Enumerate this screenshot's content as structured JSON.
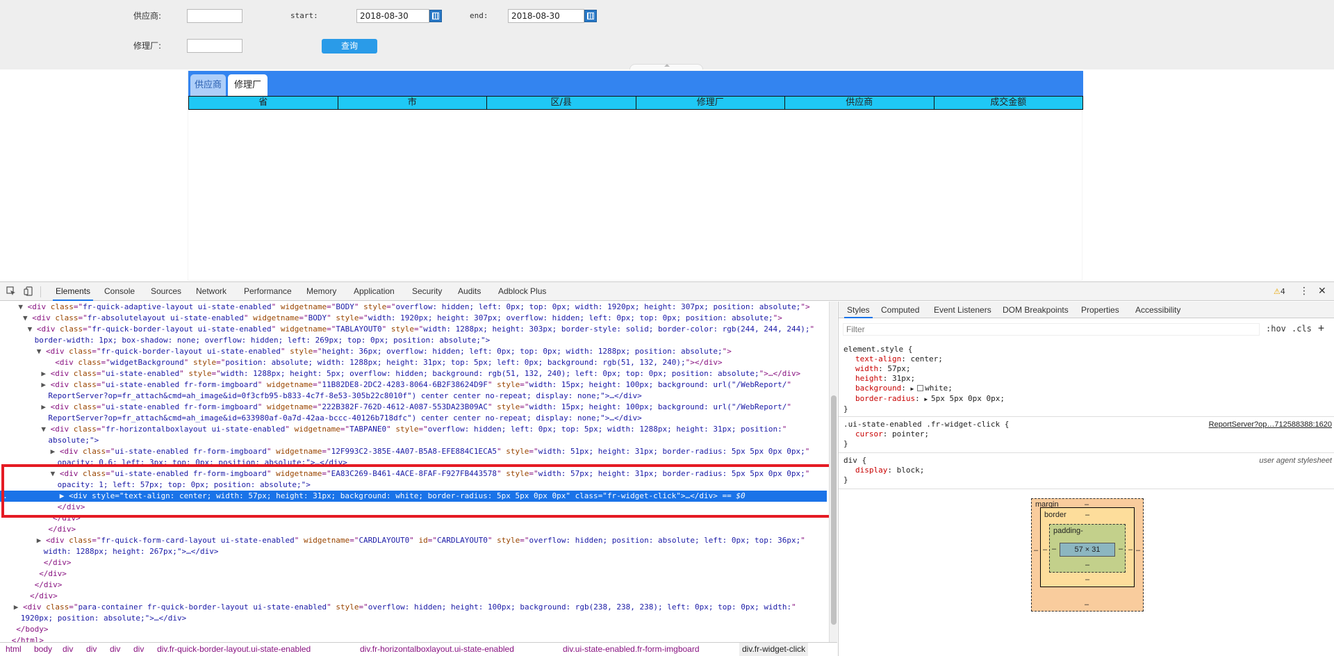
{
  "params": {
    "supplier_label": "供应商:",
    "start_label": "start:",
    "start_value": "2018-08-30",
    "end_label": "end:",
    "end_value": "2018-08-30",
    "repair_label": "修理厂:",
    "query_label": "查询"
  },
  "report": {
    "tabs": [
      "供应商",
      "修理厂"
    ],
    "columns": [
      "省",
      "市",
      "区/县",
      "修理厂",
      "供应商",
      "成交金额"
    ]
  },
  "devtools": {
    "tabs": [
      "Elements",
      "Console",
      "Sources",
      "Network",
      "Performance",
      "Memory",
      "Application",
      "Security",
      "Audits",
      "Adblock Plus"
    ],
    "warning_count": "4",
    "dom_lines": [
      {
        "indent": 4,
        "tri": "▼",
        "tag": "div",
        "attrs": [
          [
            "class",
            "fr-quick-adaptive-layout ui-state-enabled"
          ],
          [
            "widgetname",
            "BODY"
          ],
          [
            "style",
            "overflow: hidden; left: 0px; top: 0px; width: 1920px; height: 307px; position: absolute;"
          ]
        ],
        "end": ">"
      },
      {
        "indent": 5,
        "tri": "▼",
        "tag": "div",
        "attrs": [
          [
            "class",
            "fr-absolutelayout ui-state-enabled"
          ],
          [
            "widgetname",
            "BODY"
          ],
          [
            "style",
            "width: 1920px; height: 307px; overflow: hidden; left: 0px; top: 0px; position: absolute;"
          ]
        ],
        "end": ">"
      },
      {
        "indent": 6,
        "tri": "▼",
        "tag": "div",
        "attrs": [
          [
            "class",
            "fr-quick-border-layout ui-state-enabled"
          ],
          [
            "widgetname",
            "TABLAYOUT0"
          ],
          [
            "style",
            "width: 1288px; height: 303px; border-style: solid; border-color: rgb(244, 244, 244);"
          ]
        ],
        "end": ""
      },
      {
        "indent": 6,
        "text": "border-width: 1px; box-shadow: none; overflow: hidden; left: 269px; top: 0px; position: absolute;\">",
        "cont": true
      },
      {
        "indent": 8,
        "tri": "▼",
        "tag": "div",
        "attrs": [
          [
            "class",
            "fr-quick-border-layout ui-state-enabled"
          ],
          [
            "style",
            "height: 36px; overflow: hidden; left: 0px; top: 0px; width: 1288px; position: absolute;"
          ]
        ],
        "end": ">"
      },
      {
        "indent": 10,
        "tri": "",
        "tag": "div",
        "attrs": [
          [
            "class",
            "widgetBackground"
          ],
          [
            "style",
            "position: absolute; width: 1288px; height: 31px; top: 5px; left: 0px; background: rgb(51, 132, 240);"
          ]
        ],
        "end": "></div>"
      },
      {
        "indent": 9,
        "tri": "▶",
        "tag": "div",
        "attrs": [
          [
            "class",
            "ui-state-enabled"
          ],
          [
            "style",
            "width: 1288px; height: 5px; overflow: hidden; background: rgb(51, 132, 240); left: 0px; top: 0px; position: absolute;"
          ]
        ],
        "end": ">…</div>"
      },
      {
        "indent": 9,
        "tri": "▶",
        "tag": "div",
        "attrs": [
          [
            "class",
            "ui-state-enabled fr-form-imgboard"
          ],
          [
            "widgetname",
            "11B82DE8-2DC2-4283-8064-6B2F38624D9F"
          ],
          [
            "style",
            "width: 15px; height: 100px; background: url(\"/WebReport/"
          ]
        ],
        "end": ""
      },
      {
        "indent": 9,
        "text": "ReportServer?op=fr_attach&cmd=ah_image&id=0f3cfb95-b833-4c7f-8e53-305b22c8010f\") center center no-repeat; display: none;\">…</div>",
        "cont": true
      },
      {
        "indent": 9,
        "tri": "▶",
        "tag": "div",
        "attrs": [
          [
            "class",
            "ui-state-enabled fr-form-imgboard"
          ],
          [
            "widgetname",
            "222B382F-762D-4612-A087-553DA23B09AC"
          ],
          [
            "style",
            "width: 15px; height: 100px; background: url(\"/WebReport/"
          ]
        ],
        "end": ""
      },
      {
        "indent": 9,
        "text": "ReportServer?op=fr_attach&cmd=ah_image&id=633980af-0a7d-42aa-bccc-40126b718dfc\") center center no-repeat; display: none;\">…</div>",
        "cont": true
      },
      {
        "indent": 9,
        "tri": "▼",
        "tag": "div",
        "attrs": [
          [
            "class",
            "fr-horizontalboxlayout ui-state-enabled"
          ],
          [
            "widgetname",
            "TABPANE0"
          ],
          [
            "style",
            "overflow: hidden; left: 0px; top: 5px; width: 1288px; height: 31px; position:"
          ]
        ],
        "end": ""
      },
      {
        "indent": 9,
        "text": "absolute;\">",
        "cont": true
      },
      {
        "indent": 11,
        "tri": "▶",
        "tag": "div",
        "attrs": [
          [
            "class",
            "ui-state-enabled fr-form-imgboard"
          ],
          [
            "widgetname",
            "12F993C2-385E-4A07-B5A8-EFE884C1ECA5"
          ],
          [
            "style",
            "width: 51px; height: 31px; border-radius: 5px 5px 0px 0px;"
          ]
        ],
        "end": ""
      },
      {
        "indent": 11,
        "text": "opacity: 0.6; left: 3px; top: 0px; position: absolute;\">…</div>",
        "cont": true
      },
      {
        "indent": 11,
        "tri": "▼",
        "tag": "div",
        "attrs": [
          [
            "class",
            "ui-state-enabled fr-form-imgboard"
          ],
          [
            "widgetname",
            "EA83C269-B461-4ACE-8FAF-F927FB443578"
          ],
          [
            "style",
            "width: 57px; height: 31px; border-radius: 5px 5px 0px 0px;"
          ]
        ],
        "end": ""
      },
      {
        "indent": 11,
        "text": "opacity: 1; left: 57px; top: 0px; position: absolute;\">",
        "cont": true
      },
      {
        "indent": 13,
        "tri": "▶",
        "tag": "div",
        "attrs": [
          [
            "style",
            "text-align: center; width: 57px; height: 31px; background: white; border-radius: 5px 5px 0px 0px"
          ],
          [
            "class",
            "fr-widget-click"
          ]
        ],
        "end": ">…</div>",
        "sel": true
      },
      {
        "indent": 11,
        "text": "</div>",
        "close": true
      },
      {
        "indent": 10,
        "text": "</div>",
        "close": true
      },
      {
        "indent": 9,
        "text": "</div>",
        "close": true
      },
      {
        "indent": 8,
        "tri": "▶",
        "tag": "div",
        "attrs": [
          [
            "class",
            "fr-quick-form-card-layout ui-state-enabled"
          ],
          [
            "widgetname",
            "CARDLAYOUT0"
          ],
          [
            "id",
            "CARDLAYOUT0"
          ],
          [
            "style",
            "overflow: hidden; position: absolute; left: 0px; top: 36px;"
          ]
        ],
        "end": ""
      },
      {
        "indent": 8,
        "text": "width: 1288px; height: 267px;\">…</div>",
        "cont": true
      },
      {
        "indent": 8,
        "text": "</div>",
        "close": true
      },
      {
        "indent": 7,
        "text": "</div>",
        "close": true
      },
      {
        "indent": 6,
        "text": "</div>",
        "close": true
      },
      {
        "indent": 5,
        "text": "</div>",
        "close": true
      },
      {
        "indent": 3,
        "tri": "▶",
        "tag": "div",
        "attrs": [
          [
            "class",
            "para-container fr-quick-border-layout ui-state-enabled"
          ],
          [
            "style",
            "overflow: hidden; height: 100px; background: rgb(238, 238, 238); left: 0px; top: 0px; width:"
          ]
        ],
        "end": ""
      },
      {
        "indent": 3,
        "text": "1920px; position: absolute;\">…</div>",
        "cont": true
      },
      {
        "indent": 2,
        "text": "</body>",
        "close": true
      },
      {
        "indent": 1,
        "text": "</html>",
        "close": true
      }
    ],
    "selected_suffix": " == $0",
    "breadcrumbs": [
      "html",
      "body",
      "div",
      "div",
      "div",
      "div",
      "div.fr-quick-border-layout.ui-state-enabled",
      "div.fr-horizontalboxlayout.ui-state-enabled",
      "div.ui-state-enabled.fr-form-imgboard",
      "div.fr-widget-click"
    ]
  },
  "styles_panel": {
    "tabs": [
      "Styles",
      "Computed",
      "Event Listeners",
      "DOM Breakpoints",
      "Properties",
      "Accessibility"
    ],
    "filter_placeholder": "Filter",
    "hov": ":hov",
    "cls": ".cls",
    "plus": "+",
    "rules": [
      {
        "selector": "element.style {",
        "source": "",
        "decls": [
          [
            "text-align",
            "center;"
          ],
          [
            "width",
            "57px;"
          ],
          [
            "height",
            "31px;"
          ],
          [
            "background",
            "white;"
          ],
          [
            "border-radius",
            "5px 5px 0px 0px;"
          ]
        ]
      },
      {
        "selector": ".ui-state-enabled .fr-widget-click {",
        "source": "ReportServer?op…712588388:1620",
        "decls": [
          [
            "cursor",
            "pointer;"
          ]
        ]
      },
      {
        "selector": "div {",
        "source": "user agent stylesheet",
        "decls": [
          [
            "display",
            "block;"
          ]
        ]
      }
    ],
    "box_model": {
      "margin_label": "margin",
      "border_label": "border",
      "padding_label": "padding-",
      "content": "57 × 31",
      "dash": "–"
    }
  }
}
